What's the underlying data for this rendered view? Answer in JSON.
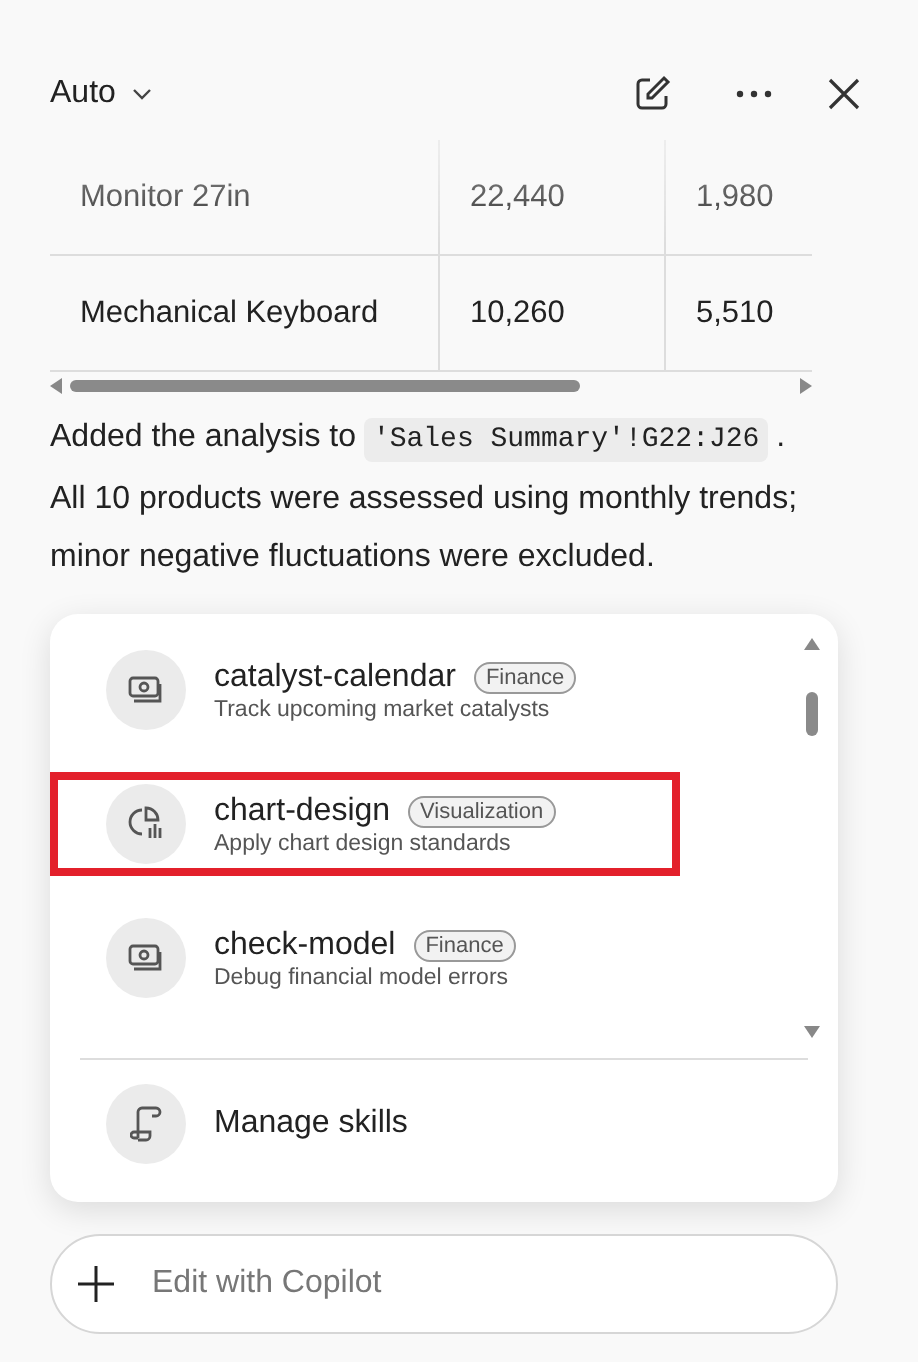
{
  "header": {
    "mode": "Auto"
  },
  "table": {
    "rows": [
      [
        "Monitor 27in",
        "22,440",
        "1,980"
      ],
      [
        "Mechanical Keyboard",
        "10,260",
        "5,510"
      ]
    ]
  },
  "message": [
    {
      "kind": "text",
      "text": "Added the analysis to "
    },
    {
      "kind": "code",
      "text": "'Sales Summary'!G22:J26"
    },
    {
      "kind": "text",
      "text": " . All 10 products were assessed using monthly trends; minor negative fluctuations were excluded."
    }
  ],
  "skills": [
    {
      "kind": "money",
      "name": "catalyst-calendar",
      "tag": "Finance",
      "description": "Track upcoming market catalysts",
      "selected": false
    },
    {
      "kind": "chart",
      "name": "chart-design",
      "tag": "Visualization",
      "description": "Apply chart design standards",
      "selected": true
    },
    {
      "kind": "money",
      "name": "check-model",
      "tag": "Finance",
      "description": "Debug financial model errors",
      "selected": false
    }
  ],
  "manage": "Manage skills",
  "composer": {
    "placeholder": "Edit with Copilot"
  }
}
